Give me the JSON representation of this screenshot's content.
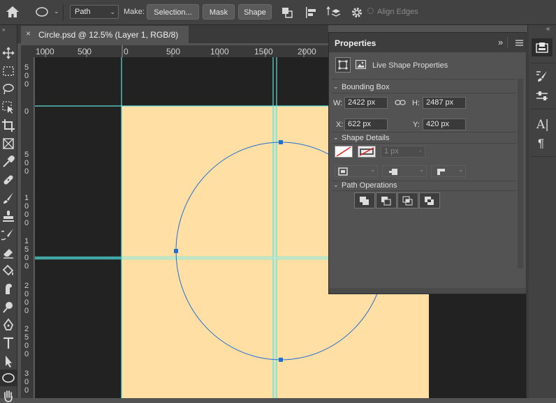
{
  "options_bar": {
    "mode_value": "Path",
    "make_label": "Make:",
    "selection_label": "Selection...",
    "mask_label": "Mask",
    "shape_label": "Shape",
    "align_edges_label": "Align Edges"
  },
  "document": {
    "tab_title": "Circle.psd @ 12.5% (Layer 1, RGB/8)"
  },
  "rulers": {
    "horizontal": [
      "1000",
      "500",
      "0",
      "500",
      "1000",
      "1500",
      "2000"
    ],
    "vertical": [
      [
        "5",
        "0",
        "0"
      ],
      [
        "0"
      ],
      [
        "5",
        "0",
        "0"
      ],
      [
        "1",
        "0",
        "0",
        "0"
      ],
      [
        "1",
        "5",
        "0",
        "0"
      ],
      [
        "2",
        "0",
        "0",
        "0"
      ],
      [
        "2",
        "5",
        "0",
        "0"
      ],
      [
        "3",
        "0",
        "0"
      ]
    ]
  },
  "properties": {
    "title": "Properties",
    "subtitle": "Live Shape Properties",
    "bounding_box": {
      "label": "Bounding Box",
      "w_label": "W:",
      "w_value": "2422 px",
      "h_label": "H:",
      "h_value": "2487 px",
      "x_label": "X:",
      "x_value": "622 px",
      "y_label": "Y:",
      "y_value": "420 px"
    },
    "shape_details": {
      "label": "Shape Details",
      "stroke_width": "1 px"
    },
    "path_operations": {
      "label": "Path Operations"
    }
  },
  "colors": {
    "canvas_fill": "#ffdfa3",
    "pasteboard": "#222222",
    "guide": "#5fe0d8",
    "path_stroke": "#1d6fd6"
  }
}
